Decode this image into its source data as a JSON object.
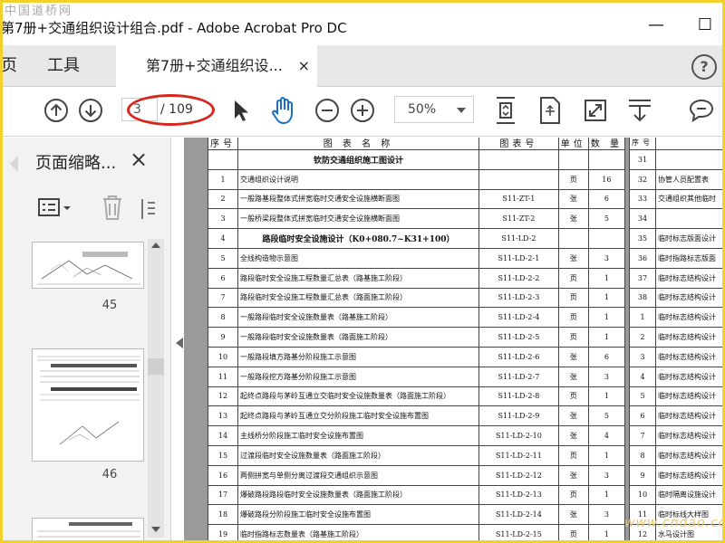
{
  "window": {
    "title": "第7册+交通组织设计组合.pdf - Adobe Acrobat Pro DC",
    "watermark": "中国道桥网",
    "minimize": "—",
    "maximize": "☐"
  },
  "tabs": {
    "home": "页",
    "tools": "工具",
    "doc": "第7册+交通组织设...",
    "doc_close": "×",
    "help": "?"
  },
  "toolbar": {
    "current_page": "3",
    "total_pages": "/ 109",
    "zoom": "50%"
  },
  "sidebar": {
    "title": "页面缩略...",
    "close": "×",
    "thumbs": [
      {
        "label": "45"
      },
      {
        "label": "46"
      }
    ]
  },
  "table": {
    "headers": [
      "序号",
      "图  表  名  称",
      "图表号",
      "单位",
      "数  量"
    ],
    "rows": [
      {
        "no": "",
        "name": "钦防交通组织施工图设计",
        "code": "",
        "unit": "",
        "qty": "",
        "section": true
      },
      {
        "no": "1",
        "name": "交通组织设计说明",
        "code": "",
        "unit": "页",
        "qty": "16"
      },
      {
        "no": "2",
        "name": "一般路基段整体式拼宽临时交通安全设施横断面图",
        "code": "S11-ZT-1",
        "unit": "张",
        "qty": "6"
      },
      {
        "no": "3",
        "name": "一般桥梁段整体式拼宽临时交通安全设施横断面图",
        "code": "S11-ZT-2",
        "unit": "张",
        "qty": "5"
      },
      {
        "no": "4",
        "name": "路段临时安全设施设计（K0+080.7~K31+100）",
        "code": "S11-LD-2",
        "unit": "",
        "qty": "",
        "section": true
      },
      {
        "no": "5",
        "name": "全线构造物示意图",
        "code": "S11-LD-2-1",
        "unit": "张",
        "qty": "3"
      },
      {
        "no": "6",
        "name": "路段临时安全设施工程数量汇总表（路基施工阶段）",
        "code": "S11-LD-2-2",
        "unit": "页",
        "qty": "1"
      },
      {
        "no": "7",
        "name": "路段临时安全设施工程数量汇总表（路面施工阶段）",
        "code": "S11-LD-2-3",
        "unit": "页",
        "qty": "1"
      },
      {
        "no": "8",
        "name": "一般路段临时安全设施数量表（路基施工阶段）",
        "code": "S11-LD-2-4",
        "unit": "页",
        "qty": "1"
      },
      {
        "no": "9",
        "name": "一般路段临时安全设施数量表（路面施工阶段）",
        "code": "S11-LD-2-5",
        "unit": "页",
        "qty": "1"
      },
      {
        "no": "10",
        "name": "一般路段填方路基分阶段施工示意图",
        "code": "S11-LD-2-6",
        "unit": "张",
        "qty": "6"
      },
      {
        "no": "11",
        "name": "一般路段挖方路基分阶段施工示意图",
        "code": "S11-LD-2-7",
        "unit": "张",
        "qty": "3"
      },
      {
        "no": "12",
        "name": "起终点路段与茅岭互通立交临时安全设施数量表（路面施工阶段）",
        "code": "S11-LD-2-8",
        "unit": "页",
        "qty": "1"
      },
      {
        "no": "13",
        "name": "起终点路段与茅岭互通立交分阶段施工临时安全设施布置图",
        "code": "S11-LD-2-9",
        "unit": "张",
        "qty": "5"
      },
      {
        "no": "14",
        "name": "主线桥分阶段施工临时安全设施布置图",
        "code": "S11-LD-2-10",
        "unit": "张",
        "qty": "4"
      },
      {
        "no": "15",
        "name": "过渡段临时安全设施数量表（路面施工阶段）",
        "code": "S11-LD-2-11",
        "unit": "页",
        "qty": "1"
      },
      {
        "no": "16",
        "name": "两侧拼宽与单侧分离过渡段交通组织示意图",
        "code": "S11-LD-2-12",
        "unit": "张",
        "qty": "3"
      },
      {
        "no": "17",
        "name": "爆破路段路段临时安全设施数量表（路面施工阶段）",
        "code": "S11-LD-2-13",
        "unit": "页",
        "qty": "1"
      },
      {
        "no": "18",
        "name": "爆破路段分阶段施工临时安全设施布置图",
        "code": "S11-LD-2-14",
        "unit": "张",
        "qty": "3"
      },
      {
        "no": "19",
        "name": "临时指路标志数量表（路基施工阶段）",
        "code": "S11-LD-2-15",
        "unit": "页",
        "qty": "1"
      }
    ]
  },
  "table2": {
    "header": "序号",
    "rows": [
      {
        "no": "31",
        "name": ""
      },
      {
        "no": "32",
        "name": "协管人员配置表"
      },
      {
        "no": "33",
        "name": "交通组织其他临时"
      },
      {
        "no": "34",
        "name": ""
      },
      {
        "no": "35",
        "name": "临时标志版面设计"
      },
      {
        "no": "36",
        "name": "临时指路标志版面"
      },
      {
        "no": "37",
        "name": "临时标志结构设计"
      },
      {
        "no": "38",
        "name": "临时标志结构设计"
      },
      {
        "no": "1",
        "name": "临时标志结构设计"
      },
      {
        "no": "2",
        "name": "临时标志结构设计"
      },
      {
        "no": "3",
        "name": "临时标志结构设计"
      },
      {
        "no": "4",
        "name": "临时标志结构设计"
      },
      {
        "no": "5",
        "name": "临时标志结构设计"
      },
      {
        "no": "6",
        "name": "临时标志结构设计"
      },
      {
        "no": "7",
        "name": "临时标志结构设计"
      },
      {
        "no": "8",
        "name": "临时标志结构设计"
      },
      {
        "no": "9",
        "name": "临时标志结构设计"
      },
      {
        "no": "10",
        "name": "临时隔离设施设计"
      },
      {
        "no": "11",
        "name": "临时标线大样图"
      },
      {
        "no": "12",
        "name": "水马设计图"
      }
    ]
  },
  "site_watermark": "www.cndao.com"
}
